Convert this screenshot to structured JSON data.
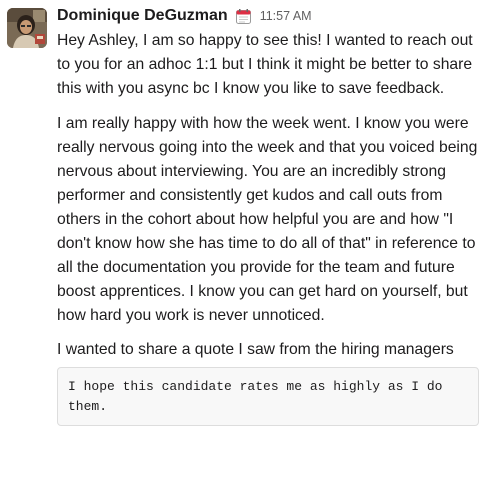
{
  "message": {
    "sender": "Dominique DeGuzman",
    "status_icon": "calendar-icon",
    "timestamp": "11:57 AM",
    "paragraphs": [
      "Hey Ashley, I am so happy to see this! I wanted to reach out to you for an adhoc 1:1 but I think it might be better to share this with you async bc I know you like to save feedback.",
      "I am really happy with how the week went. I know you were really nervous going into the week and that you voiced being nervous about interviewing. You are an incredibly strong performer and consistently get kudos and call outs from others in the cohort about how helpful you are and how \"I don't know how she has time to do all of that\" in reference to all the documentation you provide for the team and future boost apprentices. I know you can get hard on yourself, but how hard you work is never unnoticed.",
      "I wanted to share a quote I saw from the hiring managers"
    ],
    "code_block": "I hope this candidate rates me as highly as I do them."
  },
  "colors": {
    "text": "#1d1c1d",
    "timestamp": "#616061",
    "code_background": "#f8f8f8",
    "code_border": "#dddddd"
  }
}
